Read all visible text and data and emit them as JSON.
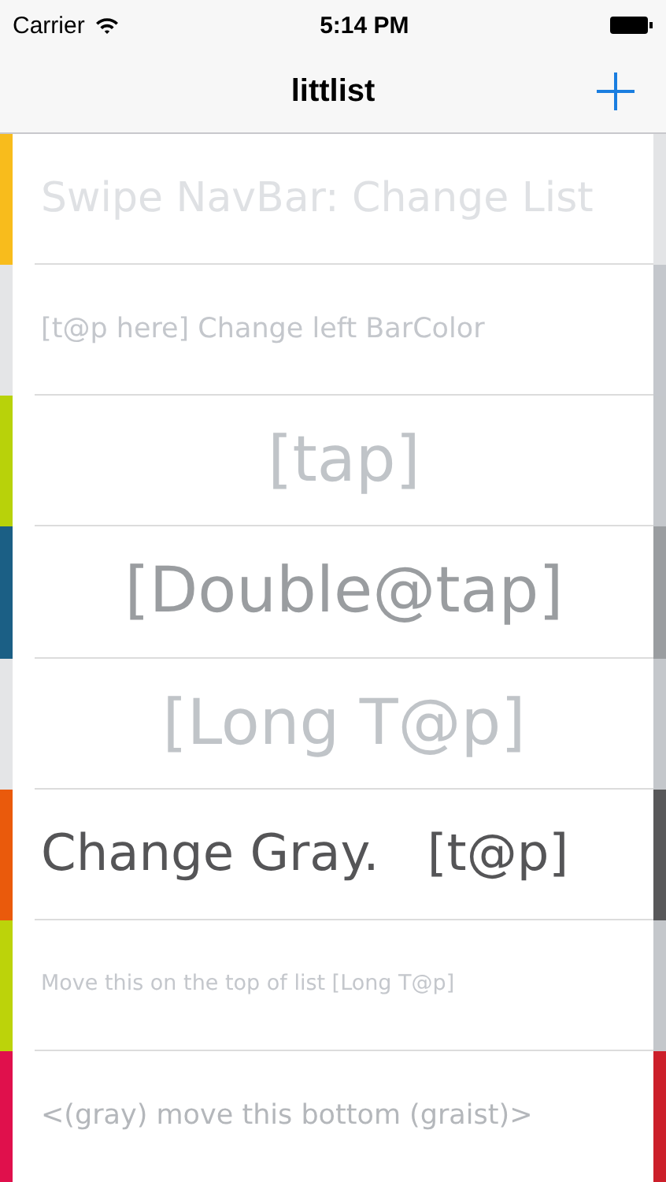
{
  "status_bar": {
    "carrier": "Carrier",
    "time": "5:14 PM"
  },
  "nav_bar": {
    "title": "littlist"
  },
  "rows": [
    {
      "kind": "lead",
      "left_bar": {
        "color": "#f8bc1c"
      },
      "label": {
        "text": "Swipe NavBar: Change List",
        "color": "#dfe1e4"
      },
      "right_bar": {
        "color": "#e3e4e6"
      }
    },
    {
      "kind": "note",
      "left_bar": {
        "color": "#e4e5e7"
      },
      "label": {
        "text": "[t@p here] Change left BarColor",
        "color": "#c4c7cc"
      },
      "right_bar": {
        "color": "#c4c7cc"
      }
    },
    {
      "kind": "big",
      "left_bar": {
        "color": "#b8d20a"
      },
      "label": {
        "text": "[tap]",
        "color": "#c0c4c8"
      },
      "right_bar": {
        "color": "#c4c7cb"
      }
    },
    {
      "kind": "big",
      "left_bar": {
        "color": "#1b5f85"
      },
      "label": {
        "text": "[Double@tap]",
        "color": "#9a9da0"
      },
      "right_bar": {
        "color": "#9a9da0"
      }
    },
    {
      "kind": "big",
      "left_bar": {
        "color": "#e4e5e7"
      },
      "label": {
        "text": "[Long T@p]",
        "color": "#c0c4c8"
      },
      "right_bar": {
        "color": "#c4c7cb"
      }
    },
    {
      "kind": "action",
      "left_bar": {
        "color": "#ea5a0c"
      },
      "label": {
        "text": "Change Gray.   [t@p]",
        "color": "#555557"
      },
      "right_bar": {
        "color": "#58585a"
      }
    },
    {
      "kind": "small",
      "left_bar": {
        "color": "#bcd30a"
      },
      "label": {
        "text": "Move this on the top of list [Long T@p]",
        "color": "#c4c7cc"
      },
      "right_bar": {
        "color": "#c4c7cb"
      }
    },
    {
      "kind": "note",
      "left_bar": {
        "color": "#e0104c"
      },
      "label": {
        "text": "<(gray) move this bottom (graist)>",
        "color": "#b4b7bb"
      },
      "right_bar": {
        "color": "#cc1f2a"
      }
    }
  ]
}
